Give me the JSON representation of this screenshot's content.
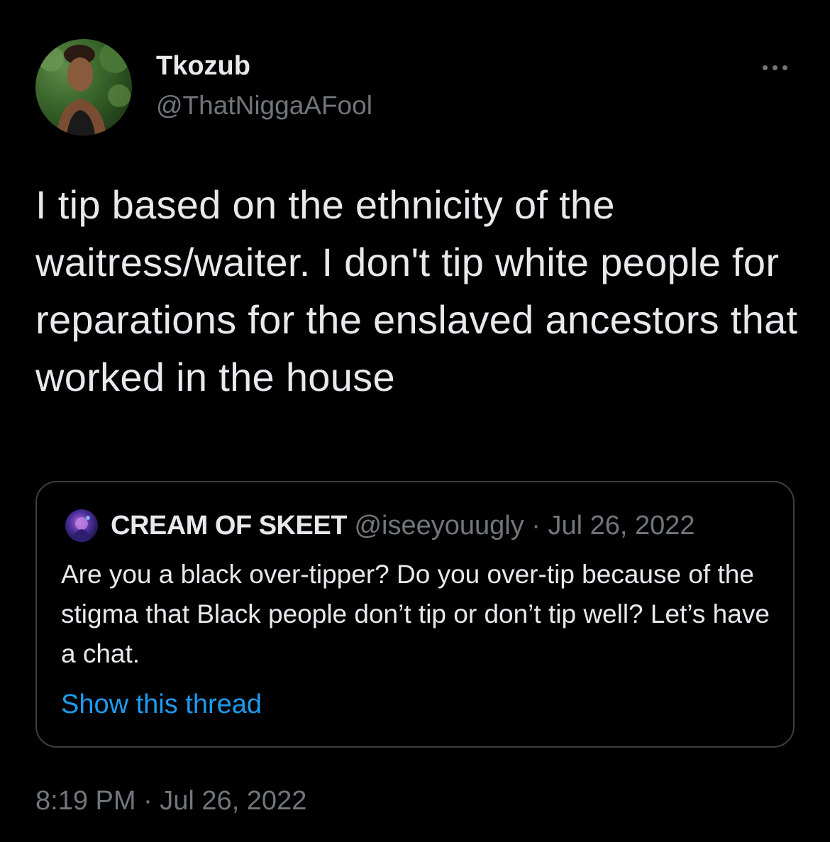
{
  "tweet": {
    "author": {
      "display_name": "Tkozub",
      "handle": "@ThatNiggaAFool",
      "avatar": "profile-photo-icon"
    },
    "more_icon": "more-horizontal-icon",
    "text": "I tip based on the ethnicity of the waitress/waiter. I don't tip white people for reparations for the enslaved ancestors that worked in the house",
    "timestamp": "8:19 PM · Jul 26, 2022"
  },
  "quoted_tweet": {
    "author": {
      "display_name": "CREAM OF SKEET",
      "handle": "@iseeyouugly",
      "avatar": "profile-photo-icon"
    },
    "date": "· Jul 26, 2022",
    "text": "Are you a black over-tipper? Do you over-tip because of the stigma that Black people don’t tip or don’t tip well? Let’s have a chat.",
    "show_thread_label": "Show this thread"
  },
  "colors": {
    "background": "#000000",
    "primary_text": "#e7e9ea",
    "secondary_text": "#71767b",
    "link": "#1d9bf0",
    "border": "#3c3f44"
  }
}
